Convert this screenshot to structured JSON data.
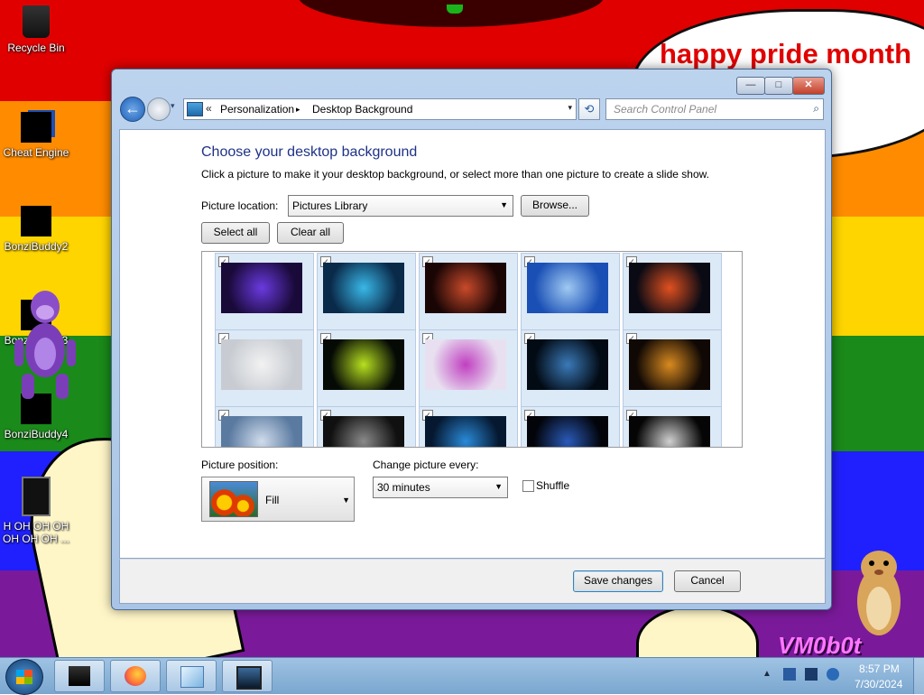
{
  "desktop": {
    "banner": "happy pride month",
    "watermark": "VM0b0t",
    "icons": [
      {
        "label": "Recycle Bin",
        "icon": "recycle-bin-icon"
      },
      {
        "label": "Cheat Engine",
        "icon": "cheat-engine-icon"
      },
      {
        "label": "BonziBuddy2",
        "icon": "bonzibuddy-icon"
      },
      {
        "label": "BonziBuddy3",
        "icon": "bonzibuddy-icon"
      },
      {
        "label": "BonziBuddy4",
        "icon": "bonzibuddy-icon"
      },
      {
        "label": "H OH OH OH OH OH OH ...",
        "icon": "text-file-icon"
      }
    ]
  },
  "window": {
    "caption_buttons": {
      "minimize": "—",
      "maximize": "□",
      "close": "✕"
    },
    "address": {
      "chevron": "«",
      "crumbs": [
        "Personalization",
        "Desktop Background"
      ],
      "separator": "▸",
      "dropdown": "▾"
    },
    "refresh_glyph": "⟲",
    "search": {
      "placeholder": "Search Control Panel",
      "icon": "search-icon"
    },
    "heading": "Choose your desktop background",
    "instructions": "Click a picture to make it your desktop background, or select more than one picture to create a slide show.",
    "picture_location": {
      "label": "Picture location:",
      "value": "Pictures Library",
      "arrow": "▼"
    },
    "browse_label": "Browse...",
    "select_all_label": "Select all",
    "clear_all_label": "Clear all",
    "gallery": {
      "checked_glyph": "✓",
      "thumbnails": [
        {
          "checked": true,
          "colors": [
            "#1a0a3a",
            "#6a3adf"
          ]
        },
        {
          "checked": true,
          "colors": [
            "#0a2a4a",
            "#39b8e8"
          ]
        },
        {
          "checked": true,
          "colors": [
            "#1a0505",
            "#c84a2a"
          ]
        },
        {
          "checked": true,
          "colors": [
            "#1a4fb5",
            "#9fc9f2"
          ]
        },
        {
          "checked": true,
          "colors": [
            "#0a0a14",
            "#e05020"
          ]
        },
        {
          "checked": true,
          "colors": [
            "#c8ccd2",
            "#f2f2f2"
          ]
        },
        {
          "checked": true,
          "colors": [
            "#050a05",
            "#b8e020"
          ]
        },
        {
          "checked": true,
          "colors": [
            "#e8e0f0",
            "#c040c0"
          ]
        },
        {
          "checked": true,
          "colors": [
            "#020a14",
            "#3a7ab8"
          ]
        },
        {
          "checked": true,
          "colors": [
            "#100804",
            "#d88a20"
          ]
        },
        {
          "checked": true,
          "colors": [
            "#5a7aa0",
            "#d0dcec"
          ]
        },
        {
          "checked": true,
          "colors": [
            "#101010",
            "#8a8a8a"
          ]
        },
        {
          "checked": true,
          "colors": [
            "#051830",
            "#2a8ad8"
          ]
        },
        {
          "checked": true,
          "colors": [
            "#02040a",
            "#2a5ab8"
          ]
        },
        {
          "checked": true,
          "colors": [
            "#050505",
            "#d0d0d0"
          ]
        }
      ],
      "scroll_up": "▲",
      "scroll_down": "▼"
    },
    "picture_position": {
      "label": "Picture position:",
      "value": "Fill",
      "arrow": "▼"
    },
    "change_every": {
      "label": "Change picture every:",
      "value": "30 minutes",
      "arrow": "▼"
    },
    "shuffle_label": "Shuffle",
    "save_label": "Save changes",
    "cancel_label": "Cancel"
  },
  "taskbar": {
    "tray_up": "▲",
    "time": "8:57 PM",
    "date": "7/30/2024"
  }
}
